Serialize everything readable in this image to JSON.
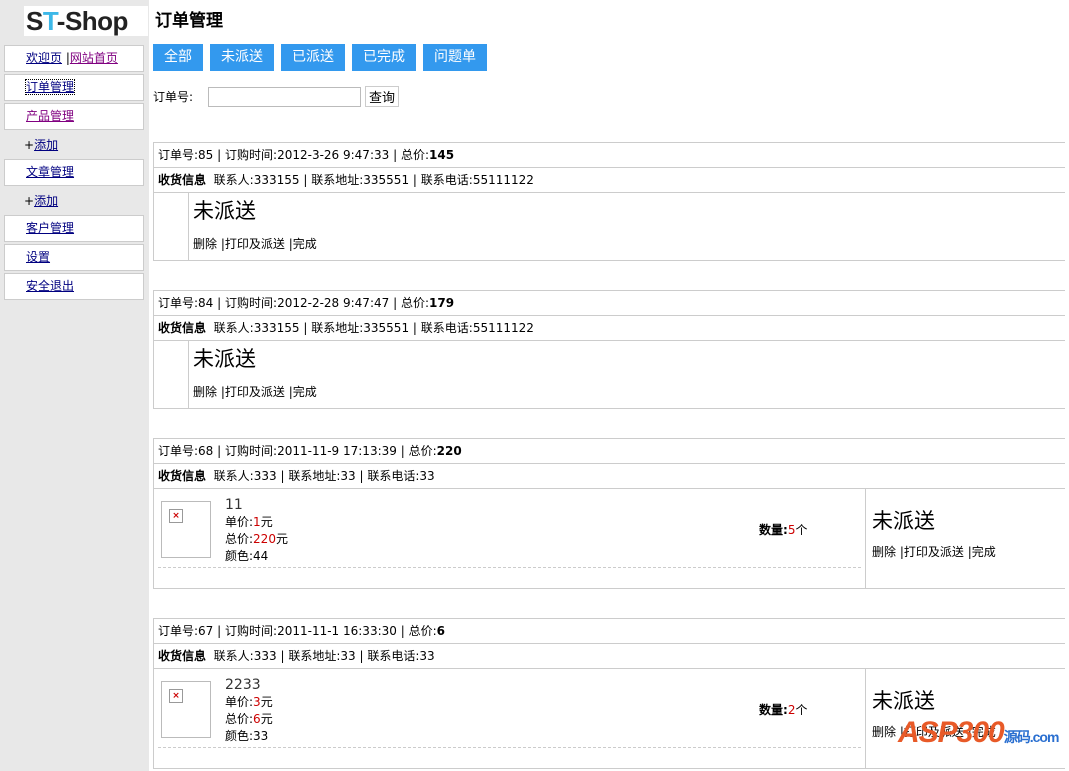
{
  "logo": {
    "text_a": "S",
    "text_t": "T",
    "text_b": "-Shop"
  },
  "sidebar": {
    "welcome": "欢迎页",
    "sep": "|",
    "home": "网站首页",
    "orders": "订单管理",
    "products": "产品管理",
    "add1": "添加",
    "plus": "+",
    "articles": "文章管理",
    "add2": "添加",
    "customers": "客户管理",
    "settings": "设置",
    "logout": "安全退出"
  },
  "page": {
    "title": "订单管理"
  },
  "tabs": [
    "全部",
    "未派送",
    "已派送",
    "已完成",
    "问题单"
  ],
  "search": {
    "label": "订单号:",
    "value": "",
    "button": "查询"
  },
  "labels": {
    "order_no": "订单号:",
    "time": "订购时间:",
    "total": "总价:",
    "recv": "收货信息",
    "contact": "联系人:",
    "addr": "联系地址:",
    "phone": "联系电话:",
    "unit": "单价:",
    "sum": "总价:",
    "color": "颜色:",
    "qty": "数量:",
    "yuan": "元",
    "ge": "个",
    "del": "删除",
    "print": "打印及派送",
    "done": "完成",
    "sep": "|"
  },
  "orders": [
    {
      "id": "85",
      "time": "2012-3-26 9:47:33",
      "total": "145",
      "contact": "333155",
      "addr": "335551",
      "phone": "55111122",
      "status": "未派送"
    },
    {
      "id": "84",
      "time": "2012-2-28 9:47:47",
      "total": "179",
      "contact": "333155",
      "addr": "335551",
      "phone": "55111122",
      "status": "未派送"
    },
    {
      "id": "68",
      "time": "2011-11-9 17:13:39",
      "total": "220",
      "contact": "333",
      "addr": "33",
      "phone": "33",
      "status": "未派送",
      "product": {
        "name": "11",
        "unit": "1",
        "sum": "220",
        "color": "44",
        "qty": "5"
      }
    },
    {
      "id": "67",
      "time": "2011-11-1 16:33:30",
      "total": "6",
      "contact": "333",
      "addr": "33",
      "phone": "33",
      "status": "未派送",
      "product": {
        "name": "2233",
        "unit": "3",
        "sum": "6",
        "color": "33",
        "qty": "2"
      }
    }
  ],
  "watermark": {
    "text": "ASP300",
    "sub": "源码.com"
  }
}
